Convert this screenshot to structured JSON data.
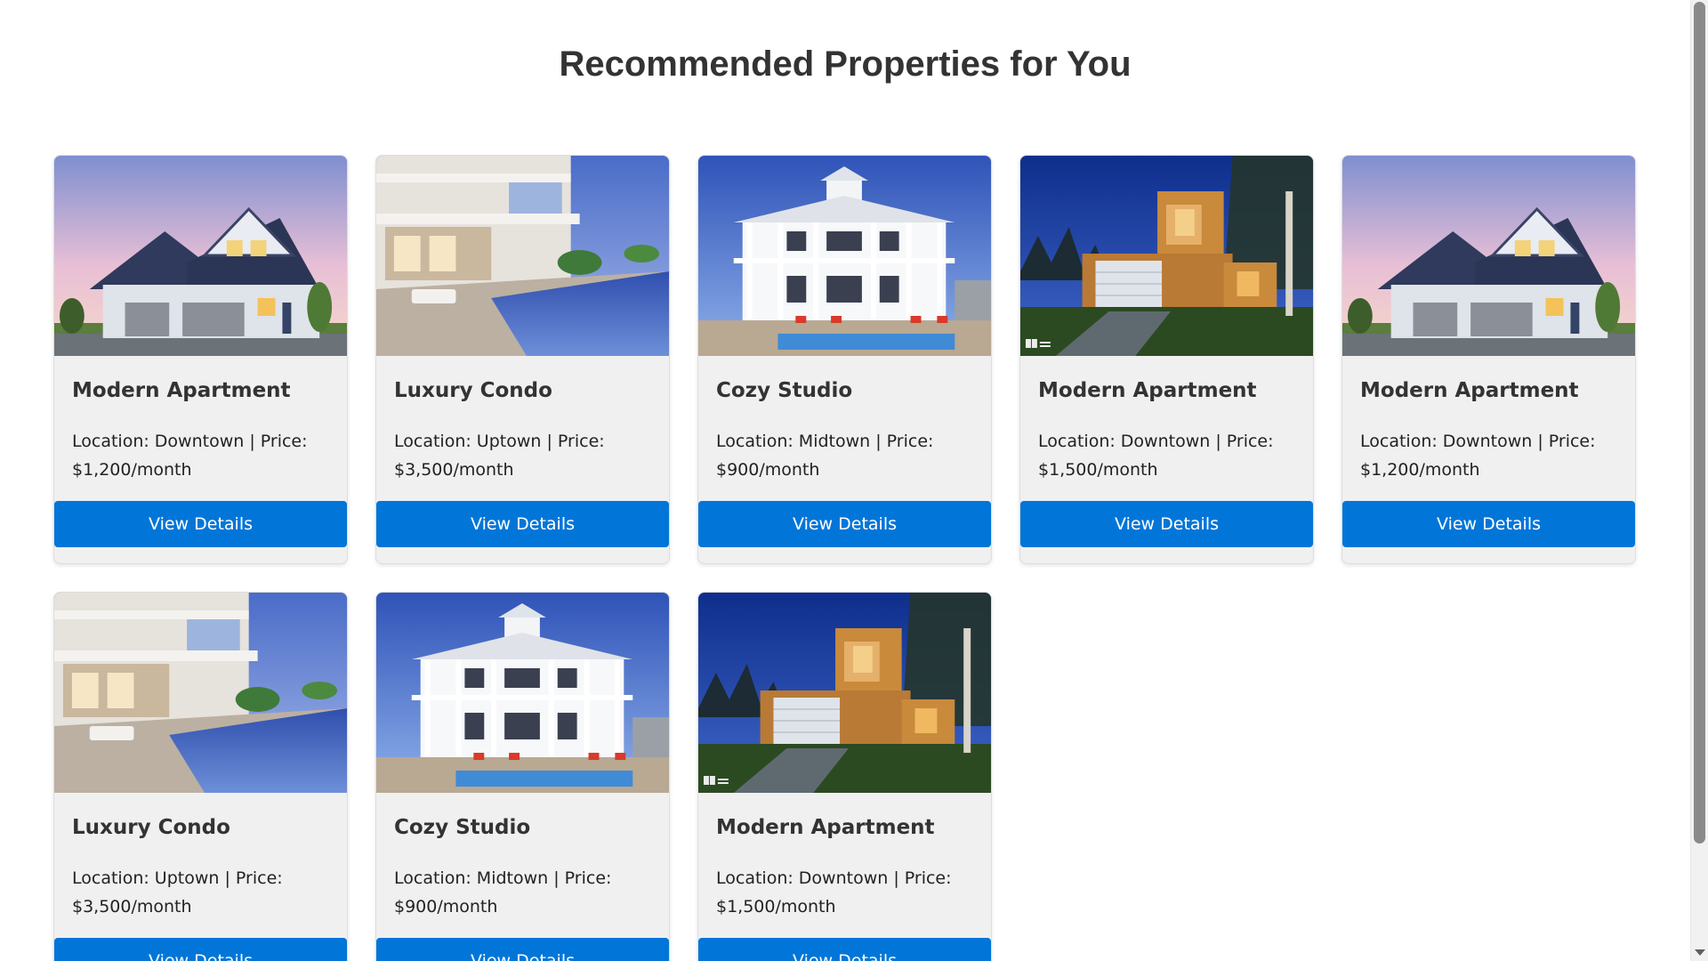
{
  "page": {
    "title": "Recommended Properties for You"
  },
  "colors": {
    "accent": "#0276d8",
    "card_background": "#f0f0f0",
    "title_text": "#333333"
  },
  "properties": [
    {
      "title": "Modern Apartment",
      "description": "Location: Downtown | Price: $1,200/month",
      "button_label": "View Details",
      "image": "suburban-house-photo"
    },
    {
      "title": "Luxury Condo",
      "description": "Location: Uptown | Price: $3,500/month",
      "button_label": "View Details",
      "image": "luxury-pool-house-photo"
    },
    {
      "title": "Cozy Studio",
      "description": "Location: Midtown | Price: $900/month",
      "button_label": "View Details",
      "image": "white-veranda-house-photo"
    },
    {
      "title": "Modern Apartment",
      "description": "Location: Downtown | Price: $1,500/month",
      "button_label": "View Details",
      "image": "modern-wood-house-night-photo"
    },
    {
      "title": "Modern Apartment",
      "description": "Location: Downtown | Price: $1,200/month",
      "button_label": "View Details",
      "image": "suburban-house-photo"
    },
    {
      "title": "Luxury Condo",
      "description": "Location: Uptown | Price: $3,500/month",
      "button_label": "View Details",
      "image": "luxury-pool-house-photo"
    },
    {
      "title": "Cozy Studio",
      "description": "Location: Midtown | Price: $900/month",
      "button_label": "View Details",
      "image": "white-veranda-house-photo"
    },
    {
      "title": "Modern Apartment",
      "description": "Location: Downtown | Price: $1,500/month",
      "button_label": "View Details",
      "image": "modern-wood-house-night-photo"
    }
  ]
}
